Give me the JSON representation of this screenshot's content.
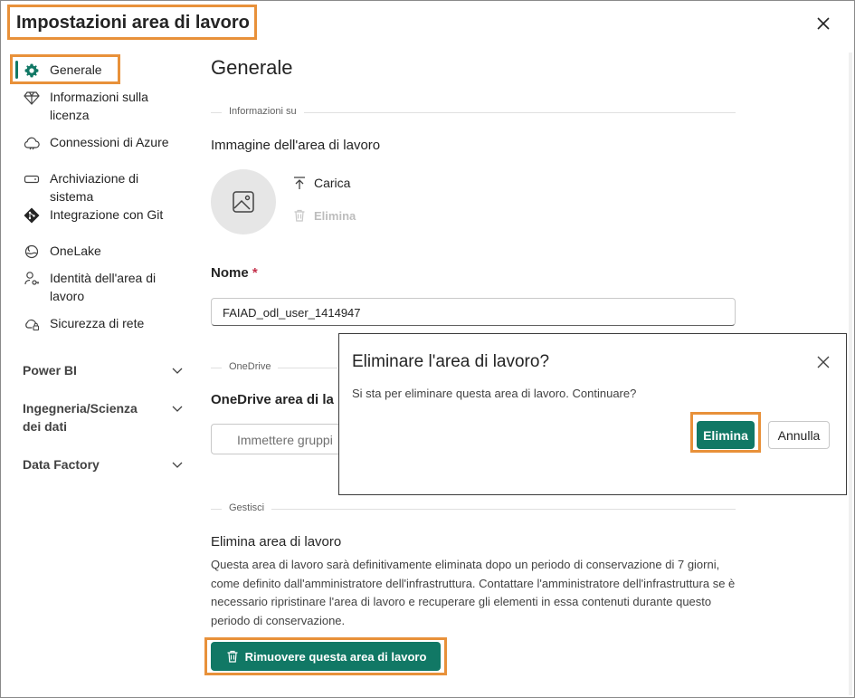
{
  "window": {
    "title": "Impostazioni area di lavoro"
  },
  "sidebar": {
    "items": [
      {
        "label": "Generale",
        "icon": "gear-icon",
        "active": true
      },
      {
        "label": "Informazioni sulla licenza",
        "icon": "diamond-icon"
      },
      {
        "label": "Connessioni di Azure",
        "icon": "cloud-icon"
      },
      {
        "label": "Archiviazione di sistema",
        "icon": "storage-icon"
      },
      {
        "label": "Integrazione con Git",
        "icon": "git-icon"
      },
      {
        "label": "OneLake",
        "icon": "onelake-icon"
      },
      {
        "label": "Identità dell'area di lavoro",
        "icon": "identity-icon"
      },
      {
        "label": "Sicurezza di rete",
        "icon": "cloud-lock-icon"
      }
    ],
    "sections": [
      {
        "label": "Power BI"
      },
      {
        "label": "Ingegneria/Scienza dei dati"
      },
      {
        "label": "Data Factory"
      }
    ]
  },
  "main": {
    "heading": "Generale",
    "about": {
      "section_label": "Informazioni su",
      "image_heading": "Immagine dell'area di lavoro",
      "upload_label": "Carica",
      "delete_label": "Elimina",
      "name_label": "Nome",
      "required_mark": "*",
      "name_value": "FAIAD_odl_user_1414947"
    },
    "onedrive": {
      "section_label": "OneDrive",
      "heading": "OneDrive area di la",
      "placeholder": "Immettere gruppi"
    },
    "manage": {
      "section_label": "Gestisci",
      "heading": "Elimina area di lavoro",
      "description": "Questa area di lavoro sarà definitivamente eliminata dopo un periodo di conservazione di 7 giorni, come definito dall'amministratore dell'infrastruttura. Contattare l'amministratore dell'infrastruttura se è necessario ripristinare l'area di lavoro e recuperare gli elementi in essa contenuti durante questo periodo di conservazione.",
      "remove_button": "Rimuovere questa area di lavoro"
    }
  },
  "dialog": {
    "title": "Eliminare l'area di lavoro?",
    "message": "Si sta per eliminare questa area di lavoro. Continuare?",
    "confirm_label": "Elimina",
    "cancel_label": "Annulla"
  },
  "colors": {
    "accent": "#117865",
    "highlight": "#e8913a",
    "required": "#c4314b"
  }
}
